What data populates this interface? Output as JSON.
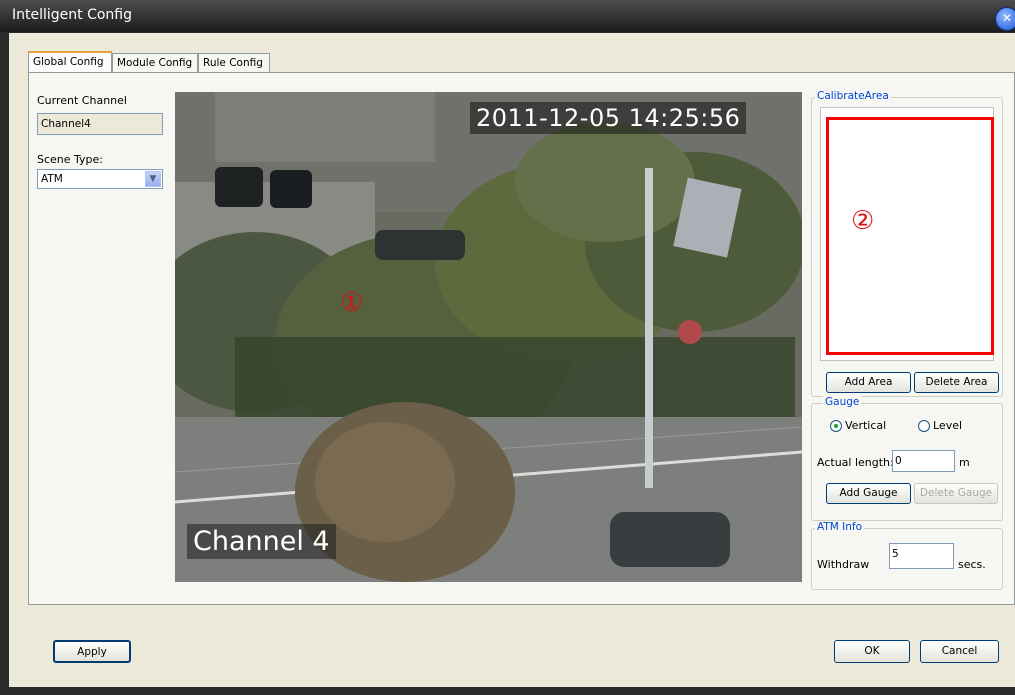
{
  "window": {
    "title": "Intelligent Config",
    "close_glyph": "✕"
  },
  "tabs": [
    {
      "label": "Global Config",
      "active": true
    },
    {
      "label": "Module Config",
      "active": false
    },
    {
      "label": "Rule Config",
      "active": false
    }
  ],
  "left": {
    "current_channel_label": "Current Channel",
    "current_channel_value": "Channel4",
    "scene_type_label": "Scene Type:",
    "scene_type_value": "ATM"
  },
  "video": {
    "timestamp": "2011-12-05 14:25:56",
    "channel_overlay": "Channel 4",
    "marker": "①"
  },
  "calibrate_area": {
    "legend": "CalibrateArea",
    "marker": "②",
    "add_area_label": "Add Area",
    "delete_area_label": "Delete Area"
  },
  "gauge": {
    "legend": "Gauge",
    "vertical_label": "Vertical",
    "level_label": "Level",
    "selected": "Vertical",
    "actual_length_label": "Actual length:",
    "actual_length_value": "0",
    "unit": "m",
    "add_gauge_label": "Add Gauge",
    "delete_gauge_label": "Delete Gauge"
  },
  "atm_info": {
    "legend": "ATM Info",
    "withdraw_label": "Withdraw",
    "withdraw_value": "5",
    "unit": "secs."
  },
  "footer": {
    "apply_label": "Apply",
    "ok_label": "OK",
    "cancel_label": "Cancel"
  },
  "colors": {
    "accent_blue": "#0046d5",
    "tab_highlight": "#e5a13e",
    "calibrate_border": "#ff0000",
    "marker_red": "#e01010"
  }
}
